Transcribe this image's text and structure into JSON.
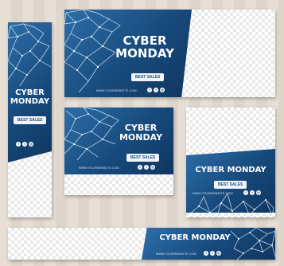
{
  "banners": {
    "wide": {
      "title_line1": "CYBER",
      "title_line2": "MONDAY",
      "button": "BEST SALES",
      "url": "WWW.YOURWEBSITE.COM",
      "icons": [
        "facebook-icon",
        "twitter-icon",
        "instagram-icon"
      ]
    },
    "tall": {
      "title_line1": "CYBER",
      "title_line2": "MONDAY",
      "button": "BEST SALES",
      "url": "",
      "icons": [
        "facebook-icon",
        "twitter-icon",
        "instagram-icon"
      ]
    },
    "medium": {
      "title_line1": "CYBER",
      "title_line2": "MONDAY",
      "button": "BEST SALES",
      "url": "WWW.YOURWEBSITE.COM",
      "icons": [
        "facebook-icon",
        "twitter-icon",
        "instagram-icon"
      ]
    },
    "square": {
      "title": "CYBER MONDAY",
      "button": "BEST SALES",
      "url": "WWW.YOURWEBSITE.COM",
      "icons": [
        "facebook-icon",
        "twitter-icon",
        "instagram-icon"
      ]
    },
    "leaderboard": {
      "title": "CYBER MONDAY",
      "url": "WWW.YOURWEBSITE.COM",
      "icons": [
        "facebook-icon",
        "twitter-icon",
        "instagram-icon"
      ]
    }
  },
  "colors": {
    "brand_blue": "#174a7c",
    "background": "#e4dbd0",
    "text": "#ffffff"
  }
}
